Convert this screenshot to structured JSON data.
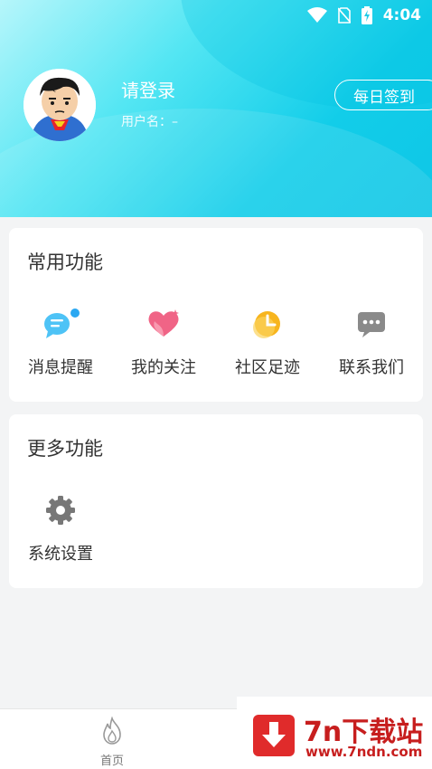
{
  "status_bar": {
    "time": "4:04"
  },
  "profile": {
    "login_text": "请登录",
    "username_text": "用户名：–",
    "checkin_label": "每日签到"
  },
  "common_functions": {
    "title": "常用功能",
    "items": [
      {
        "label": "消息提醒",
        "icon": "message-icon",
        "color": "#3bb8f5"
      },
      {
        "label": "我的关注",
        "icon": "heart-icon",
        "color": "#f0587a"
      },
      {
        "label": "社区足迹",
        "icon": "clock-icon",
        "color": "#f7b51e"
      },
      {
        "label": "联系我们",
        "icon": "chat-icon",
        "color": "#8a8a8a"
      }
    ]
  },
  "more_functions": {
    "title": "更多功能",
    "items": [
      {
        "label": "系统设置",
        "icon": "gear-icon",
        "color": "#777777"
      }
    ]
  },
  "tabbar": {
    "home_label": "首页"
  },
  "watermark": {
    "title": "7n下载站",
    "url": "www.7ndn.com"
  },
  "colors": {
    "header_accent": "#12cde9",
    "notification_dot": "#2aa8f2"
  }
}
